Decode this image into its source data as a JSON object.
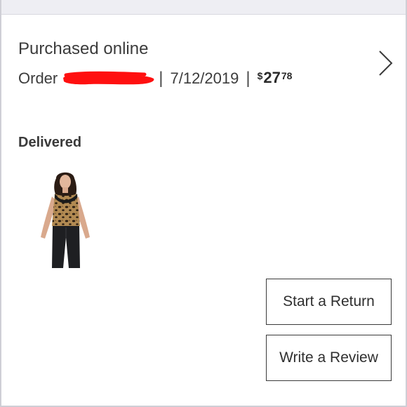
{
  "order_card": {
    "title": "Purchased online",
    "order_label": "Order",
    "date": "7/12/2019",
    "separator": "|",
    "price": {
      "currency": "$",
      "dollars": "27",
      "cents": "78"
    },
    "status": "Delivered"
  },
  "actions": {
    "start_return": "Start a Return",
    "write_review": "Write a Review"
  },
  "icons": {
    "details_chevron": "chevron-right-icon"
  },
  "colors": {
    "redaction": "#ff1010",
    "text": "#3c3c3c",
    "border": "#3a3a3a",
    "top_bar": "#eeeef3"
  }
}
